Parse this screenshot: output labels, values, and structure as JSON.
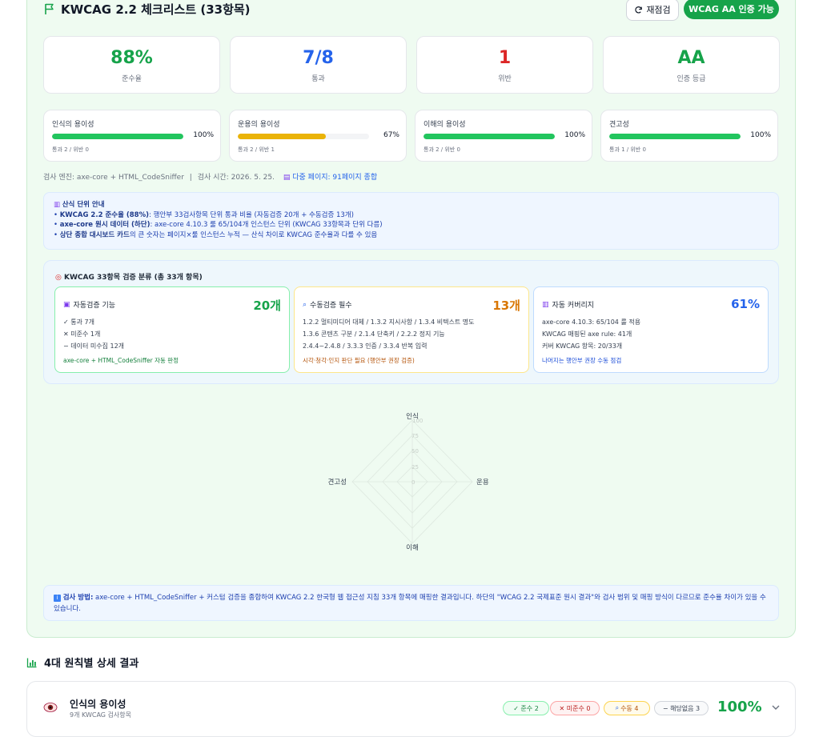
{
  "header": {
    "title": "KWCAG 2.2 체크리스트 (33항목)",
    "recheck_label": "재점검",
    "cert_badge": "WCAG AA 인증 가능"
  },
  "stats": [
    {
      "value": "88%",
      "label": "준수율",
      "color": "#16a34a"
    },
    {
      "value": "7/8",
      "label": "통과",
      "color": "#2563eb"
    },
    {
      "value": "1",
      "label": "위반",
      "color": "#dc2626"
    },
    {
      "value": "AA",
      "label": "인증 등급",
      "color": "#16a34a"
    }
  ],
  "principles": [
    {
      "title": "인식의 용이성",
      "percent": "100%",
      "fill": 1.0,
      "color": "#22c55e",
      "sub": "통과 2 / 위반 0"
    },
    {
      "title": "운용의 용이성",
      "percent": "67%",
      "fill": 0.67,
      "color": "#eab308",
      "sub": "통과 2 / 위반 1"
    },
    {
      "title": "이해의 용이성",
      "percent": "100%",
      "fill": 1.0,
      "color": "#22c55e",
      "sub": "통과 2 / 위반 0"
    },
    {
      "title": "견고성",
      "percent": "100%",
      "fill": 1.0,
      "color": "#22c55e",
      "sub": "통과 1 / 위반 0"
    }
  ],
  "meta": {
    "engine": "검사 엔진: axe-core + HTML_CodeSniffer",
    "sep": "|",
    "time": "검사 시간: 2026. 5. 25.",
    "pages": "다중 페이지: 91페이지 종합"
  },
  "note": {
    "title": "산식 단위 안내",
    "l1_b": "KWCAG 2.2 준수율 (88%)",
    "l1_t": ": 행안부 33검사항목 단위 통과 비율 (자동검증 20개 + 수동검증 13개)",
    "l2_b": "axe-core 원시 데이터 (하단)",
    "l2_t": ": axe-core 4.10.3 룰 65/104개 인스턴스 단위 (KWCAG 33항목과 단위 다름)",
    "l3_b": "상단 종합 대시보드 카드",
    "l3_t": "의 큰 숫자는 페이지×룰 인스턴스 누적 — 산식 차이로 KWCAG 준수율과 다를 수 있음"
  },
  "classification": {
    "title": "KWCAG 33항목 검증 분류 (총 33개 항목)",
    "cards": [
      {
        "title": "자동검증 기능",
        "count": "20개",
        "lines": [
          "✓ 통과 7개",
          "✕ 미준수 1개",
          "− 데이터 미수집 12개"
        ],
        "foot": "axe-core + HTML_CodeSniffer 자동 판정"
      },
      {
        "title": "수동검증 필수",
        "count": "13개",
        "lines": [
          "1.2.2 멀티미디어 대체 / 1.3.2 지시사항 / 1.3.4 비텍스트 명도",
          "1.3.6 콘텐츠 구분 / 2.1.4 단축키 / 2.2.2 정지 기능",
          "2.4.4~2.4.8 / 3.3.3 인증 / 3.3.4 반복 입력"
        ],
        "foot": "시각·청각·인지 판단 필요 (행안부 권장 검증)"
      },
      {
        "title": "자동 커버리지",
        "count": "61%",
        "lines": [
          "axe-core 4.10.3: 65/104 룰 적용",
          "KWCAG 매핑된 axe rule: 41개",
          "커버 KWCAG 항목: 20/33개"
        ],
        "foot": "나머지는 행안부 권장 수동 점검"
      }
    ]
  },
  "radar": {
    "axes": [
      "인식",
      "운용",
      "이해",
      "견고성"
    ],
    "ticks": [
      "100",
      "75",
      "50",
      "25",
      "0"
    ]
  },
  "bottom_note": {
    "label": "검사 방법:",
    "text": "axe-core + HTML_CodeSniffer + 커스텀 검증을 종합하여 KWCAG 2.2 한국형 웹 접근성 지침 33개 항목에 매핑한 결과입니다. 하단의 \"WCAG 2.2 국제표준 원시 결과\"와 검사 범위 및 매핑 방식이 다르므로 준수율 차이가 있을 수 있습니다."
  },
  "section": {
    "title": "4대 원칙별 상세 결과"
  },
  "principle_row": {
    "name": "인식의 용이성",
    "count": "9개 KWCAG 검사항목",
    "pill_pass": "✓ 준수 2",
    "pill_fail": "✕ 미준수 0",
    "pill_manual": "수동 4",
    "pill_na": "− 해당없음 3",
    "percent": "100%"
  }
}
